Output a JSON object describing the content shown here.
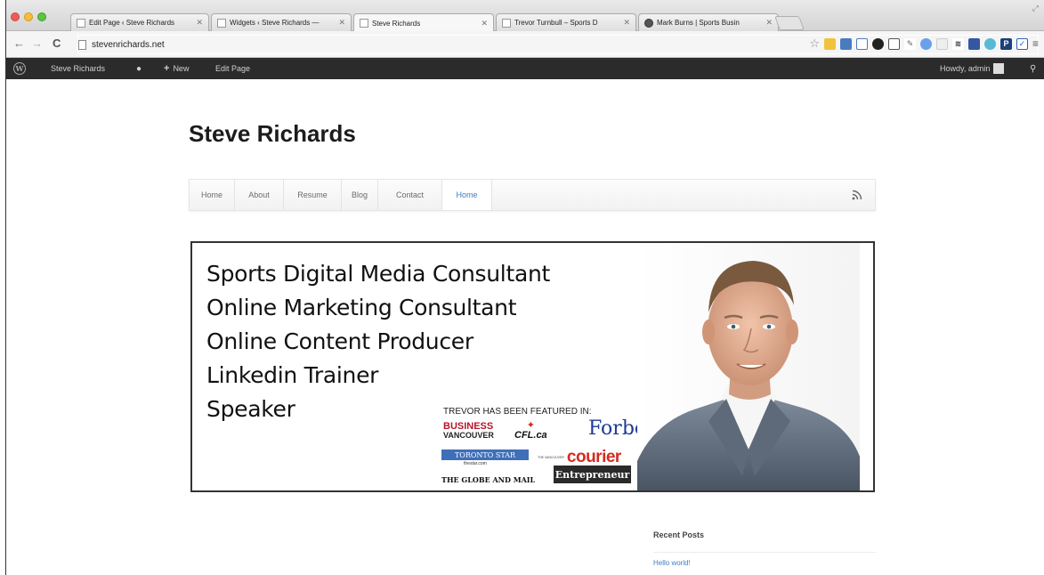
{
  "browser": {
    "tabs": [
      {
        "label": "Edit Page ‹ Steve Richards",
        "active": false
      },
      {
        "label": "Widgets ‹ Steve Richards — ",
        "active": false
      },
      {
        "label": "Steve Richards",
        "active": true
      },
      {
        "label": "Trevor Turnbull – Sports D",
        "active": false
      },
      {
        "label": "Mark Burns | Sports Busin",
        "active": false
      }
    ],
    "url": "stevenrichards.net"
  },
  "adminbar": {
    "site_name": "Steve Richards",
    "new_label": "New",
    "edit_label": "Edit Page",
    "howdy": "Howdy, admin"
  },
  "site": {
    "title": "Steve Richards",
    "nav": [
      "Home",
      "About",
      "Resume",
      "Blog",
      "Contact",
      "Home"
    ],
    "current_nav_index": 5
  },
  "banner": {
    "roles": [
      "Sports Digital Media Consultant",
      "Online Marketing Consultant",
      "Online Content Producer",
      "Linkedin Trainer",
      "Speaker"
    ],
    "featured_heading": "TREVOR HAS BEEN FEATURED IN:",
    "logos": {
      "business_line1": "BUSINESS",
      "business_line2": "VANCOUVER",
      "cfl": "CFL.ca",
      "forbes": "Forbes",
      "toronto_star": "TORONTO STAR",
      "thestar": "thestar.com",
      "courier_prefix": "THE VANCOUVER",
      "courier": "courier",
      "globe": "THE GLOBE AND MAIL",
      "entrepreneur": "Entrepreneur"
    }
  },
  "sidebar": {
    "heading": "Recent Posts",
    "posts": [
      "Hello world!"
    ]
  },
  "colors": {
    "admin_bar": "#2b2b2b",
    "link": "#3c7fc1",
    "forbes": "#1f3a93",
    "courier": "#d42b1e"
  }
}
